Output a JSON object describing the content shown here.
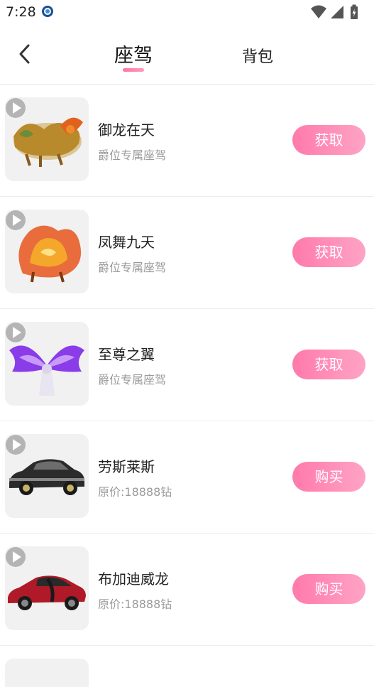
{
  "status": {
    "time": "7:28"
  },
  "header": {
    "tabs": [
      {
        "label": "座驾",
        "active": true
      },
      {
        "label": "背包",
        "active": false
      }
    ]
  },
  "items": [
    {
      "name": "御龙在天",
      "subtitle": "爵位专属座驾",
      "action": "获取",
      "icon": "dragon-icon"
    },
    {
      "name": "凤舞九天",
      "subtitle": "爵位专属座驾",
      "action": "获取",
      "icon": "phoenix-icon"
    },
    {
      "name": "至尊之翼",
      "subtitle": "爵位专属座驾",
      "action": "获取",
      "icon": "wings-icon"
    },
    {
      "name": "劳斯莱斯",
      "subtitle": "原价:18888钻",
      "action": "购买",
      "icon": "car-icon"
    },
    {
      "name": "布加迪威龙",
      "subtitle": "原价:18888钻",
      "action": "购买",
      "icon": "sports-car-icon"
    }
  ],
  "colors": {
    "accent_start": "#ff7aaa",
    "accent_end": "#ffa3c5"
  }
}
